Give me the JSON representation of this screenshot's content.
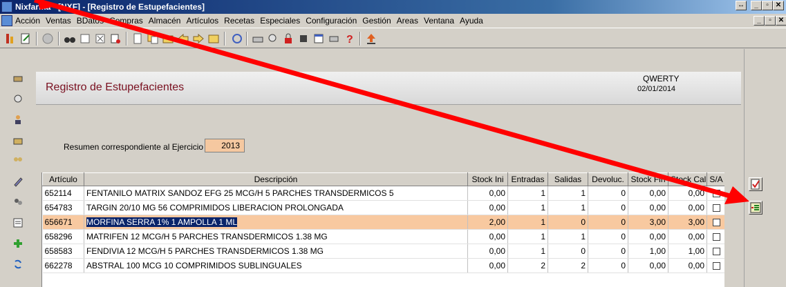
{
  "window": {
    "title": "Nixfarma - [NXF] - [Registro de Estupefacientes]"
  },
  "menu": [
    "Acción",
    "Ventas",
    "BDatos",
    "Compras",
    "Almacén",
    "Artículos",
    "Recetas",
    "Especiales",
    "Configuración",
    "Gestión",
    "Areas",
    "Ventana",
    "Ayuda"
  ],
  "form": {
    "title": "Registro de Estupefacientes",
    "user": "QWERTY",
    "date": "02/01/2014",
    "resumen_label": "Resumen correspondiente al Ejercicio",
    "year": "2013"
  },
  "grid": {
    "columns": [
      "Artículo",
      "Descripción",
      "Stock Ini",
      "Entradas",
      "Salidas",
      "Devoluc.",
      "Stock Fin",
      "Stock Cal",
      "S/A"
    ],
    "rows": [
      {
        "articulo": "652114",
        "descripcion": "FENTANILO MATRIX SANDOZ EFG 25 MCG/H 5 PARCHES TRANSDERMICOS 5",
        "stock_ini": "0,00",
        "entradas": "1",
        "salidas": "1",
        "devoluc": "0",
        "stock_fin": "0,00",
        "stock_cal": "0,00"
      },
      {
        "articulo": "654783",
        "descripcion": "TARGIN 20/10 MG 56 COMPRIMIDOS LIBERACION PROLONGADA",
        "stock_ini": "0,00",
        "entradas": "1",
        "salidas": "1",
        "devoluc": "0",
        "stock_fin": "0,00",
        "stock_cal": "0,00"
      },
      {
        "articulo": "656671",
        "descripcion": "MORFINA SERRA 1% 1 AMPOLLA 1 ML",
        "stock_ini": "2,00",
        "entradas": "1",
        "salidas": "0",
        "devoluc": "0",
        "stock_fin": "3,00",
        "stock_cal": "3,00",
        "selected": true
      },
      {
        "articulo": "658296",
        "descripcion": "MATRIFEN 12 MCG/H 5 PARCHES TRANSDERMICOS 1.38 MG",
        "stock_ini": "0,00",
        "entradas": "1",
        "salidas": "1",
        "devoluc": "0",
        "stock_fin": "0,00",
        "stock_cal": "0,00"
      },
      {
        "articulo": "658583",
        "descripcion": "FENDIVIA 12 MCG/H 5 PARCHES TRANSDERMICOS 1.38 MG",
        "stock_ini": "0,00",
        "entradas": "1",
        "salidas": "0",
        "devoluc": "0",
        "stock_fin": "1,00",
        "stock_cal": "1,00"
      },
      {
        "articulo": "662278",
        "descripcion": "ABSTRAL 100 MCG 10 COMPRIMIDOS SUBLINGUALES",
        "stock_ini": "0,00",
        "entradas": "2",
        "salidas": "2",
        "devoluc": "0",
        "stock_fin": "0,00",
        "stock_cal": "0,00"
      }
    ]
  },
  "colors": {
    "selected_row": "#f8c9a0",
    "title_color": "#7a1020",
    "arrow": "#ff0000"
  }
}
